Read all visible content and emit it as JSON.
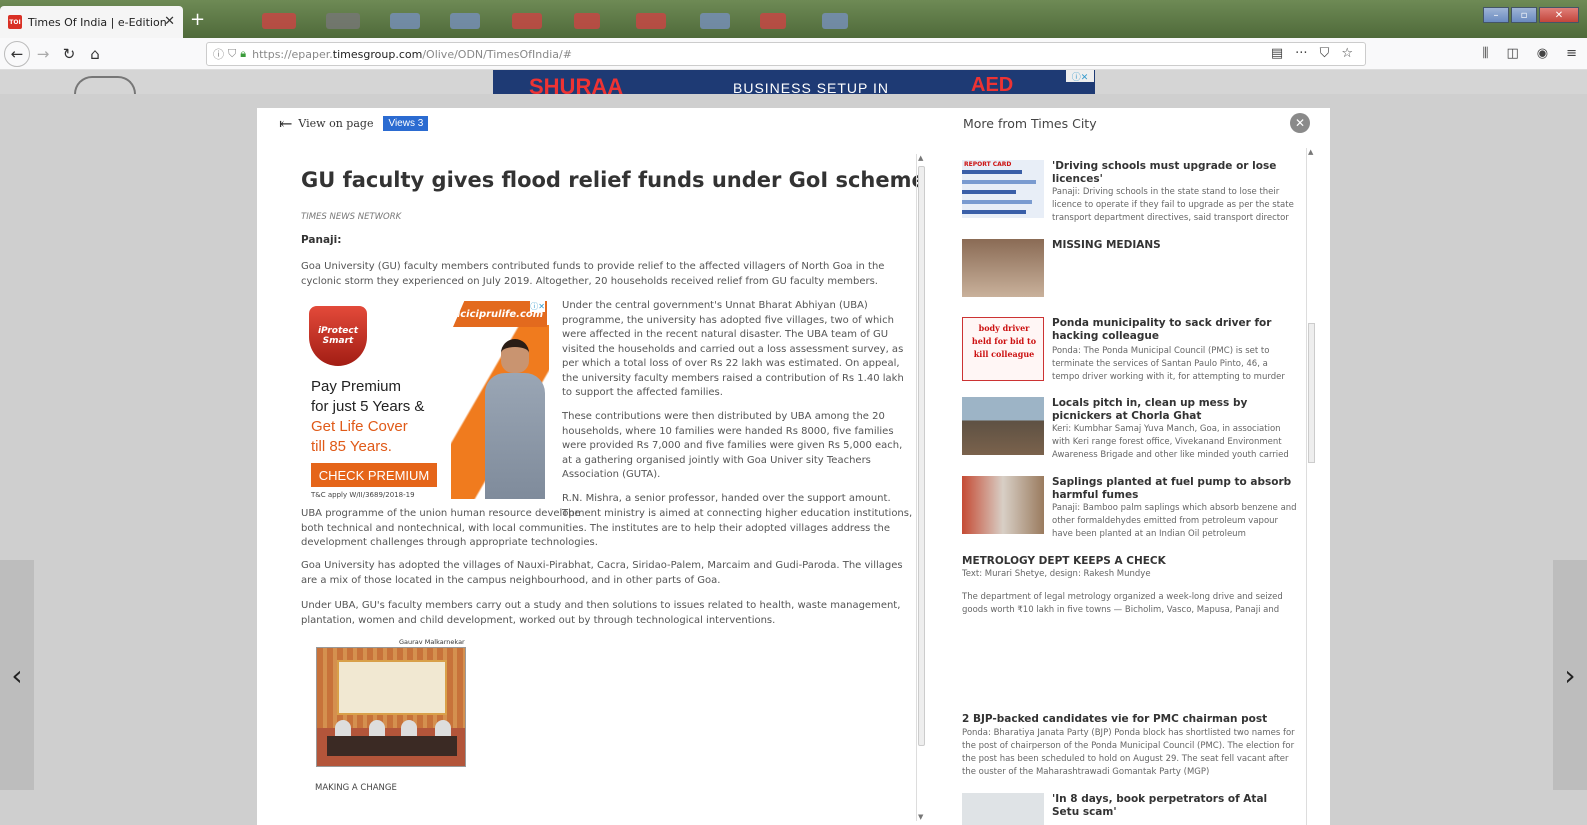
{
  "browser": {
    "tab_title": "Times Of India | e-Edition",
    "tab_favicon": "TOI",
    "tab_close": "✕",
    "new_tab": "+",
    "url_prefix": "https://epaper.",
    "url_host": "timesgroup.com",
    "url_path": "/Olive/ODN/TimesOfIndia/#",
    "icons": [
      "back-icon",
      "forward-icon",
      "reload-icon",
      "home-icon",
      "info-icon",
      "shield-icon",
      "lock-icon",
      "reader-icon",
      "more-icon",
      "pocket-icon",
      "bookmark-star-icon",
      "library-icon",
      "sidebar-icon",
      "account-icon",
      "menu-icon"
    ]
  },
  "header_ad": {
    "brand": "SHURAA",
    "tagline": "BUSINESS SETUP IN",
    "price": "AED"
  },
  "viewer": {
    "view_on_page": "View on page",
    "views_badge": "Views 3"
  },
  "article": {
    "headline": "GU faculty gives flood relief funds under GoI scheme",
    "byline": "TIMES NEWS NETWORK",
    "dateline": "Panaji:",
    "p1": "Goa University (GU) faculty members contributed funds to provide relief to the affected villagers of North Goa in the cyclonic storm they experienced on July 2019. Altogether, 20 households received relief from GU faculty members.",
    "p2": "Under the central government's Unnat Bharat Abhiyan (UBA) programme, the university has adopted five villages, two of which were affected in the recent natural disaster. The UBA team of GU visited the households and carried out a loss assessment survey, as per which a total loss of over Rs 22 lakh was estimated. On appeal, the university faculty members raised a contribution of Rs 1.40 lakh to support the affected families.",
    "p3": "These contributions were then distributed by UBA among the 20 households, where 10 families were handed Rs 8000, five families were provided Rs 7,000 and five families were given Rs 5,000 each, at a gathering organised jointly with Goa Univer sity Teachers Association (GUTA).",
    "p4a": "R.N. Mishra, a senior professor, handed over the support amount. The",
    "p4b": "UBA programme of the union human resource development ministry is aimed at connecting higher education institutions, both technical and nontechnical, with local communities. The institutes are to help their adopted villages address the development challenges through appropriate technologies.",
    "p5": "Goa University has adopted the villages of Nauxi-Pirabhat, Cacra, Siridao-Palem, Marcaim and Gudi-Paroda. The villages are a mix of those located in the campus neighbourhood, and in other parts of Goa.",
    "p6": "Under UBA, GU's faculty members carry out a study and then solutions to issues related to health, waste management, plantation, women and child development, worked out by through technological interventions.",
    "photo_credit": "Gaurav Malkarnekar",
    "caption": "MAKING A CHANGE"
  },
  "article_ad": {
    "badge_line1": "iProtect",
    "badge_line2": "Smart",
    "brand": "iciciprulife.com",
    "line1": "Pay Premium",
    "line2": "for just 5 Years &",
    "line3": "Get Life Cover",
    "line4": "till 85 Years.",
    "cta": "CHECK PREMIUM",
    "tc": "T&C apply W/II/3689/2018-19",
    "close": "ⓘ✕"
  },
  "related": {
    "heading": "More from Times City",
    "thumb_labels": {
      "report_card": "REPORT CARD",
      "ponda_1": "body driver",
      "ponda_2": "held for bid to",
      "ponda_3": "kill colleague"
    },
    "items": [
      {
        "title": "'Driving schools must upgrade or lose licences'",
        "snippet": "Panaji: Driving schools in the state stand to lose their licence to operate if they fail to upgrade as per the state transport department directives, said transport director"
      },
      {
        "title": "MISSING MEDIANS",
        "snippet": ""
      },
      {
        "title": "Ponda municipality to sack driver for hacking colleague",
        "snippet": "Ponda: The Ponda Municipal Council (PMC) is set to terminate the services of Santan Paulo Pinto, 46, a tempo driver working with it, for attempting to murder"
      },
      {
        "title": "Locals pitch in, clean up mess by picnickers at Chorla Ghat",
        "snippet": "Keri: Kumbhar Samaj Yuva Manch, Goa, in association with Keri range forest office, Vivekanand Environment Awareness Brigade and other like minded youth carried"
      },
      {
        "title": "Saplings planted at fuel pump to absorb harmful fumes",
        "snippet": "Panaji: Bamboo palm saplings which absorb benzene and other formaldehydes emitted from petroleum vapour have been planted at an Indian Oil petroleum"
      },
      {
        "title": "METROLOGY DEPT KEEPS A CHECK",
        "credit": "Text: Murari Shetye, design: Rakesh Mundye",
        "snippet": "The department of legal metrology organized a week-long drive and seized goods worth ₹10 lakh in five towns — Bicholim, Vasco, Mapusa, Panaji and"
      },
      {
        "title": "2 BJP-backed candidates vie for PMC chairman post",
        "snippet": "Ponda: Bharatiya Janata Party (BJP) Ponda block has shortlisted two names for the post of chairperson of the Ponda Municipal Council (PMC). The election for the post has been scheduled to hold on August 29. The seat fell vacant after the ouster of the Maharashtrawadi Gomantak Party (MGP)"
      },
      {
        "title": "'In 8 days, book perpetrators of Atal Setu scam'",
        "snippet": ""
      }
    ]
  },
  "nav": {
    "prev": "‹",
    "next": "›"
  }
}
